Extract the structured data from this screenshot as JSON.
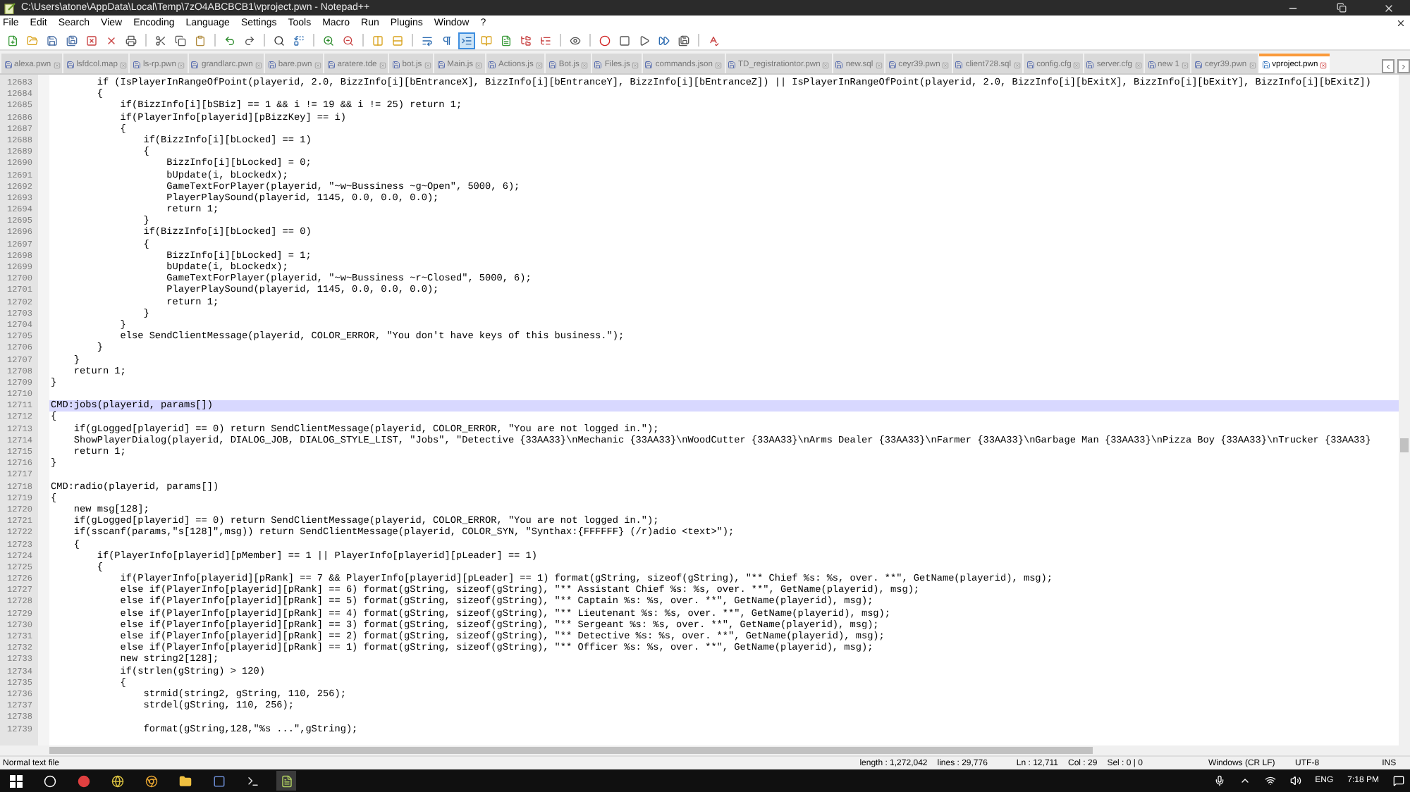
{
  "window": {
    "title": "C:\\Users\\atone\\AppData\\Local\\Temp\\7zO4ABCBCB1\\vproject.pwn - Notepad++"
  },
  "menu": [
    "File",
    "Edit",
    "Search",
    "View",
    "Encoding",
    "Language",
    "Settings",
    "Tools",
    "Macro",
    "Run",
    "Plugins",
    "Window",
    "?"
  ],
  "toolbar": [
    {
      "selected": false
    },
    {
      "selected": false
    },
    {
      "selected": false
    },
    {
      "selected": false
    },
    {
      "selected": false
    },
    {
      "selected": false
    },
    {
      "selected": false
    },
    {
      "selected": false
    },
    {
      "selected": false
    },
    {
      "selected": false
    },
    {
      "selected": false
    },
    {
      "selected": false
    },
    {
      "selected": false
    },
    {
      "selected": false
    },
    {
      "selected": false
    },
    {
      "selected": false
    },
    {
      "selected": false
    },
    {
      "selected": false
    },
    {
      "selected": false
    },
    {
      "selected": false
    },
    {
      "selected": true
    },
    {
      "selected": false
    },
    {
      "selected": false
    },
    {
      "selected": false
    },
    {
      "selected": false
    },
    {
      "selected": false
    },
    {
      "selected": false
    },
    {
      "selected": false
    },
    {
      "selected": false
    },
    {
      "selected": false
    },
    {
      "selected": false
    },
    {
      "selected": false
    }
  ],
  "tabs": [
    {
      "label": "alexa.pwn",
      "selected": false
    },
    {
      "label": "lsfdcol.map",
      "selected": false
    },
    {
      "label": "ls-rp.pwn",
      "selected": false
    },
    {
      "label": "grandlarc.pwn",
      "selected": false
    },
    {
      "label": "bare.pwn",
      "selected": false
    },
    {
      "label": "aratere.tde",
      "selected": false
    },
    {
      "label": "bot.js",
      "selected": false
    },
    {
      "label": "Main.js",
      "selected": false
    },
    {
      "label": "Actions.js",
      "selected": false
    },
    {
      "label": "Bot.js",
      "selected": false
    },
    {
      "label": "Files.js",
      "selected": false
    },
    {
      "label": "commands.json",
      "selected": false
    },
    {
      "label": "TD_registrationtor.pwn",
      "selected": false
    },
    {
      "label": "new.sql",
      "selected": false
    },
    {
      "label": "ceyr39.pwn",
      "selected": false
    },
    {
      "label": "client728.sql",
      "selected": false
    },
    {
      "label": "config.cfg",
      "selected": false
    },
    {
      "label": "server.cfg",
      "selected": false
    },
    {
      "label": "new 1",
      "selected": false
    },
    {
      "label": "ceyr39.pwn",
      "selected": false
    },
    {
      "label": "vproject.pwn",
      "selected": true
    }
  ],
  "editor": {
    "lines": [
      {
        "number": "12683",
        "selected": false,
        "text": "        if (IsPlayerInRangeOfPoint(playerid, 2.0, BizzInfo[i][bEntranceX], BizzInfo[i][bEntranceY], BizzInfo[i][bEntranceZ]) || IsPlayerInRangeOfPoint(playerid, 2.0, BizzInfo[i][bExitX], BizzInfo[i][bExitY], BizzInfo[i][bExitZ])"
      },
      {
        "number": "12684",
        "selected": false,
        "text": "        {"
      },
      {
        "number": "12685",
        "selected": false,
        "text": "            if(BizzInfo[i][bSBiz] == 1 && i != 19 && i != 25) return 1;"
      },
      {
        "number": "12686",
        "selected": false,
        "text": "            if(PlayerInfo[playerid][pBizzKey] == i)"
      },
      {
        "number": "12687",
        "selected": false,
        "text": "            {"
      },
      {
        "number": "12688",
        "selected": false,
        "text": "                if(BizzInfo[i][bLocked] == 1)"
      },
      {
        "number": "12689",
        "selected": false,
        "text": "                {"
      },
      {
        "number": "12690",
        "selected": false,
        "text": "                    BizzInfo[i][bLocked] = 0;"
      },
      {
        "number": "12691",
        "selected": false,
        "text": "                    bUpdate(i, bLockedx);"
      },
      {
        "number": "12692",
        "selected": false,
        "text": "                    GameTextForPlayer(playerid, \"~w~Bussiness ~g~Open\", 5000, 6);"
      },
      {
        "number": "12693",
        "selected": false,
        "text": "                    PlayerPlaySound(playerid, 1145, 0.0, 0.0, 0.0);"
      },
      {
        "number": "12694",
        "selected": false,
        "text": "                    return 1;"
      },
      {
        "number": "12695",
        "selected": false,
        "text": "                }"
      },
      {
        "number": "12696",
        "selected": false,
        "text": "                if(BizzInfo[i][bLocked] == 0)"
      },
      {
        "number": "12697",
        "selected": false,
        "text": "                {"
      },
      {
        "number": "12698",
        "selected": false,
        "text": "                    BizzInfo[i][bLocked] = 1;"
      },
      {
        "number": "12699",
        "selected": false,
        "text": "                    bUpdate(i, bLockedx);"
      },
      {
        "number": "12700",
        "selected": false,
        "text": "                    GameTextForPlayer(playerid, \"~w~Bussiness ~r~Closed\", 5000, 6);"
      },
      {
        "number": "12701",
        "selected": false,
        "text": "                    PlayerPlaySound(playerid, 1145, 0.0, 0.0, 0.0);"
      },
      {
        "number": "12702",
        "selected": false,
        "text": "                    return 1;"
      },
      {
        "number": "12703",
        "selected": false,
        "text": "                }"
      },
      {
        "number": "12704",
        "selected": false,
        "text": "            }"
      },
      {
        "number": "12705",
        "selected": false,
        "text": "            else SendClientMessage(playerid, COLOR_ERROR, \"You don't have keys of this business.\");"
      },
      {
        "number": "12706",
        "selected": false,
        "text": "        }"
      },
      {
        "number": "12707",
        "selected": false,
        "text": "    }"
      },
      {
        "number": "12708",
        "selected": false,
        "text": "    return 1;"
      },
      {
        "number": "12709",
        "selected": false,
        "text": "}"
      },
      {
        "number": "12710",
        "selected": false
      },
      {
        "number": "12711",
        "selected": true,
        "text": "CMD:jobs(playerid, params[])"
      },
      {
        "number": "12712",
        "selected": false,
        "text": "{"
      },
      {
        "number": "12713",
        "selected": false,
        "text": "    if(gLogged[playerid] == 0) return SendClientMessage(playerid, COLOR_ERROR, \"You are not logged in.\");"
      },
      {
        "number": "12714",
        "selected": false,
        "text": "    ShowPlayerDialog(playerid, DIALOG_JOB, DIALOG_STYLE_LIST, \"Jobs\", \"Detective {33AA33}\\nMechanic {33AA33}\\nWoodCutter {33AA33}\\nArms Dealer {33AA33}\\nFarmer {33AA33}\\nGarbage Man {33AA33}\\nPizza Boy {33AA33}\\nTrucker {33AA33}"
      },
      {
        "number": "12715",
        "selected": false,
        "text": "    return 1;"
      },
      {
        "number": "12716",
        "selected": false,
        "text": "}"
      },
      {
        "number": "12717",
        "selected": false
      },
      {
        "number": "12718",
        "selected": false,
        "text": "CMD:radio(playerid, params[])"
      },
      {
        "number": "12719",
        "selected": false,
        "text": "{"
      },
      {
        "number": "12720",
        "selected": false,
        "text": "    new msg[128];"
      },
      {
        "number": "12721",
        "selected": false,
        "text": "    if(gLogged[playerid] == 0) return SendClientMessage(playerid, COLOR_ERROR, \"You are not logged in.\");"
      },
      {
        "number": "12722",
        "selected": false,
        "text": "    if(sscanf(params,\"s[128]\",msg)) return SendClientMessage(playerid, COLOR_SYN, \"Synthax:{FFFFFF} (/r)adio <text>\");"
      },
      {
        "number": "12723",
        "selected": false,
        "text": "    {"
      },
      {
        "number": "12724",
        "selected": false,
        "text": "        if(PlayerInfo[playerid][pMember] == 1 || PlayerInfo[playerid][pLeader] == 1)"
      },
      {
        "number": "12725",
        "selected": false,
        "text": "        {"
      },
      {
        "number": "12726",
        "selected": false,
        "text": "            if(PlayerInfo[playerid][pRank] == 7 && PlayerInfo[playerid][pLeader] == 1) format(gString, sizeof(gString), \"** Chief %s: %s, over. **\", GetName(playerid), msg);"
      },
      {
        "number": "12727",
        "selected": false,
        "text": "            else if(PlayerInfo[playerid][pRank] == 6) format(gString, sizeof(gString), \"** Assistant Chief %s: %s, over. **\", GetName(playerid), msg);"
      },
      {
        "number": "12728",
        "selected": false,
        "text": "            else if(PlayerInfo[playerid][pRank] == 5) format(gString, sizeof(gString), \"** Captain %s: %s, over. **\", GetName(playerid), msg);"
      },
      {
        "number": "12729",
        "selected": false,
        "text": "            else if(PlayerInfo[playerid][pRank] == 4) format(gString, sizeof(gString), \"** Lieutenant %s: %s, over. **\", GetName(playerid), msg);"
      },
      {
        "number": "12730",
        "selected": false,
        "text": "            else if(PlayerInfo[playerid][pRank] == 3) format(gString, sizeof(gString), \"** Sergeant %s: %s, over. **\", GetName(playerid), msg);"
      },
      {
        "number": "12731",
        "selected": false,
        "text": "            else if(PlayerInfo[playerid][pRank] == 2) format(gString, sizeof(gString), \"** Detective %s: %s, over. **\", GetName(playerid), msg);"
      },
      {
        "number": "12732",
        "selected": false,
        "text": "            else if(PlayerInfo[playerid][pRank] == 1) format(gString, sizeof(gString), \"** Officer %s: %s, over. **\", GetName(playerid), msg);"
      },
      {
        "number": "12733",
        "selected": false,
        "text": "            new string2[128];"
      },
      {
        "number": "12734",
        "selected": false,
        "text": "            if(strlen(gString) > 120)"
      },
      {
        "number": "12735",
        "selected": false,
        "text": "            {"
      },
      {
        "number": "12736",
        "selected": false,
        "text": "                strmid(string2, gString, 110, 256);"
      },
      {
        "number": "12737",
        "selected": false,
        "text": "                strdel(gString, 110, 256);"
      },
      {
        "number": "12738",
        "selected": false
      },
      {
        "number": "12739",
        "selected": false,
        "text": "                format(gString,128,\"%s ...\",gString);"
      }
    ]
  },
  "status_bar": {
    "file_type": "Normal text file",
    "length": "length : 1,272,042",
    "lines": "lines : 29,776",
    "ln": "Ln : 12,711",
    "col": "Col : 29",
    "sel": "Sel : 0 | 0",
    "eol": "Windows (CR LF)",
    "encoding": "UTF-8",
    "mode": "INS"
  },
  "taskbar": {
    "language": "ENG",
    "time": "7:18 PM"
  }
}
